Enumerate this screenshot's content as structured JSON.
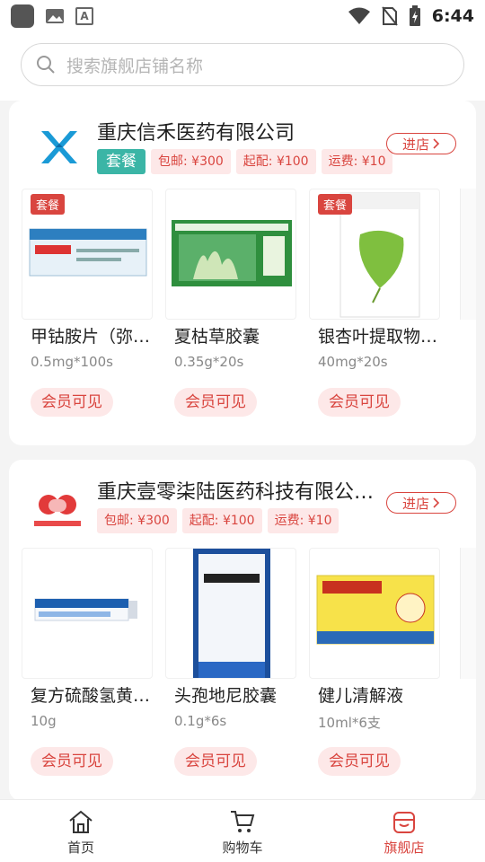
{
  "status_bar": {
    "time": "6:44",
    "icons": [
      "app-icon",
      "gallery-icon",
      "font-icon",
      "wifi-icon",
      "no-sim-icon",
      "battery-charging-icon"
    ]
  },
  "search": {
    "placeholder": "搜索旗舰店铺名称",
    "icon": "search-icon"
  },
  "stores": [
    {
      "name": "重庆信禾医药有限公司",
      "package_tag": "套餐",
      "tags": [
        "包邮: ¥300",
        "起配: ¥100",
        "运费: ¥10"
      ],
      "enter_label": "进店",
      "products": [
        {
          "name": "甲钴胺片（弥…",
          "spec": "0.5mg*100s",
          "price": "会员可见",
          "badge": "套餐"
        },
        {
          "name": "夏枯草胶囊",
          "spec": "0.35g*20s",
          "price": "会员可见",
          "badge": ""
        },
        {
          "name": "银杏叶提取物…",
          "spec": "40mg*20s",
          "price": "会员可见",
          "badge": "套餐"
        }
      ]
    },
    {
      "name": "重庆壹零柒陆医药科技有限公…",
      "package_tag": "",
      "tags": [
        "包邮: ¥300",
        "起配: ¥100",
        "运费: ¥10"
      ],
      "enter_label": "进店",
      "products": [
        {
          "name": "复方硫酸氢黄…",
          "spec": "10g",
          "price": "会员可见",
          "badge": ""
        },
        {
          "name": "头孢地尼胶囊",
          "spec": "0.1g*6s",
          "price": "会员可见",
          "badge": ""
        },
        {
          "name": "健儿清解液",
          "spec": "10ml*6支",
          "price": "会员可见",
          "badge": ""
        }
      ]
    }
  ],
  "bottom_nav": [
    {
      "label": "首页",
      "icon": "home-icon",
      "active": false
    },
    {
      "label": "购物车",
      "icon": "cart-icon",
      "active": false
    },
    {
      "label": "旗舰店",
      "icon": "store-icon",
      "active": true
    }
  ],
  "colors": {
    "accent": "#d9453f",
    "tag_bg": "#fde8e8",
    "package": "#3bb5a6"
  }
}
